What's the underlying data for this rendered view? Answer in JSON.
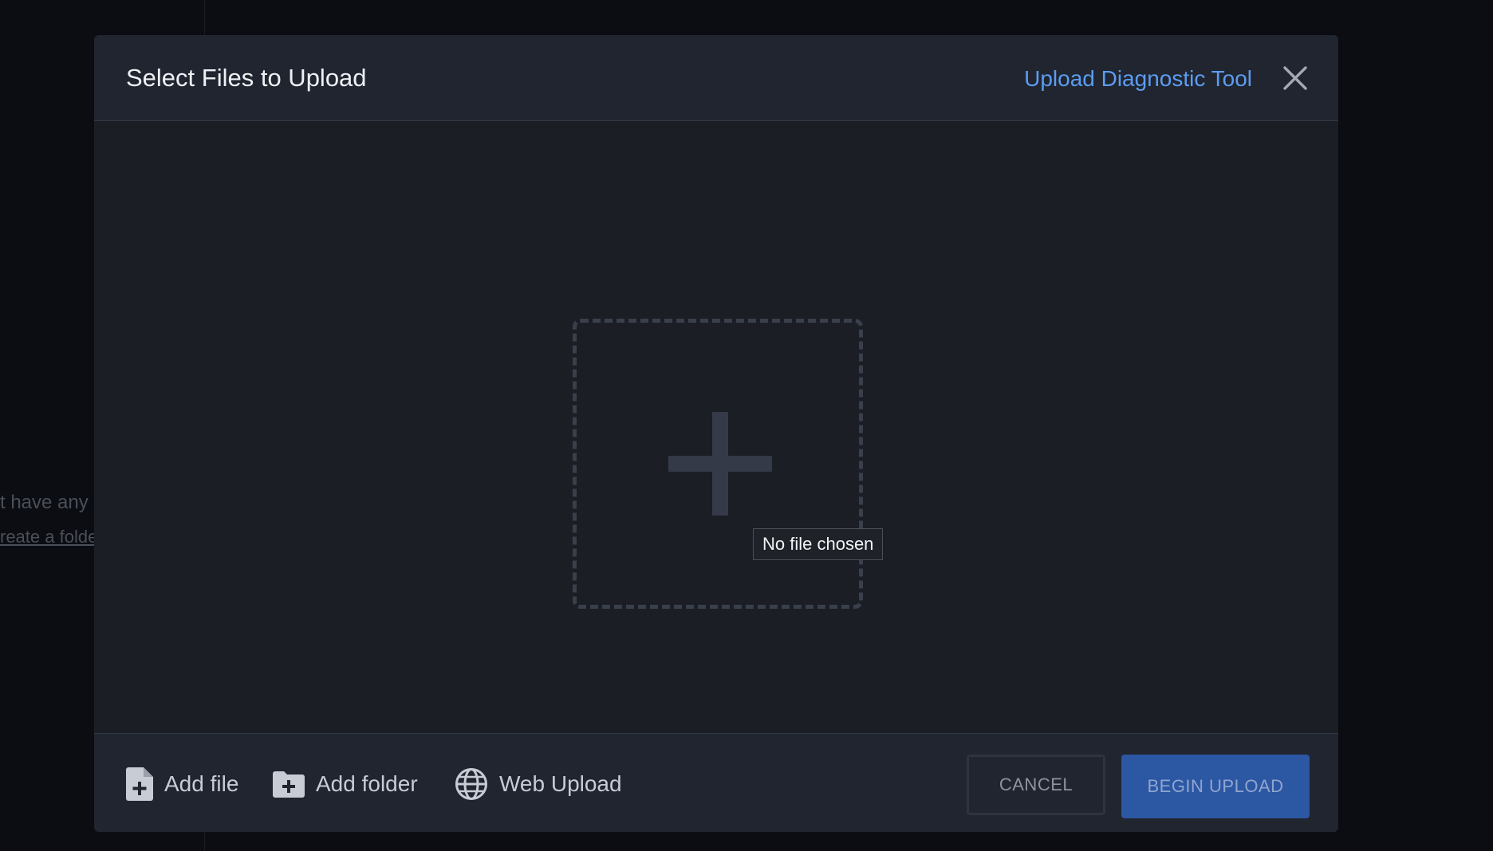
{
  "background": {
    "line1": "t have any",
    "line2": "reate a folde"
  },
  "modal": {
    "title": "Select Files to Upload",
    "diagnostic_link": "Upload Diagnostic Tool",
    "close_icon": "close-icon"
  },
  "dropzone": {
    "icon": "plus-icon",
    "tooltip": "No file chosen"
  },
  "footer": {
    "add_file_label": "Add file",
    "add_file_icon": "file-plus-icon",
    "add_folder_label": "Add folder",
    "add_folder_icon": "folder-plus-icon",
    "web_upload_label": "Web Upload",
    "web_upload_icon": "globe-icon",
    "cancel_label": "CANCEL",
    "begin_upload_label": "BEGIN UPLOAD"
  },
  "colors": {
    "accent": "#5c9cf0",
    "primary_button": "#2c57a3",
    "modal_bg": "#1b1e25",
    "page_bg": "#0b0d12"
  }
}
